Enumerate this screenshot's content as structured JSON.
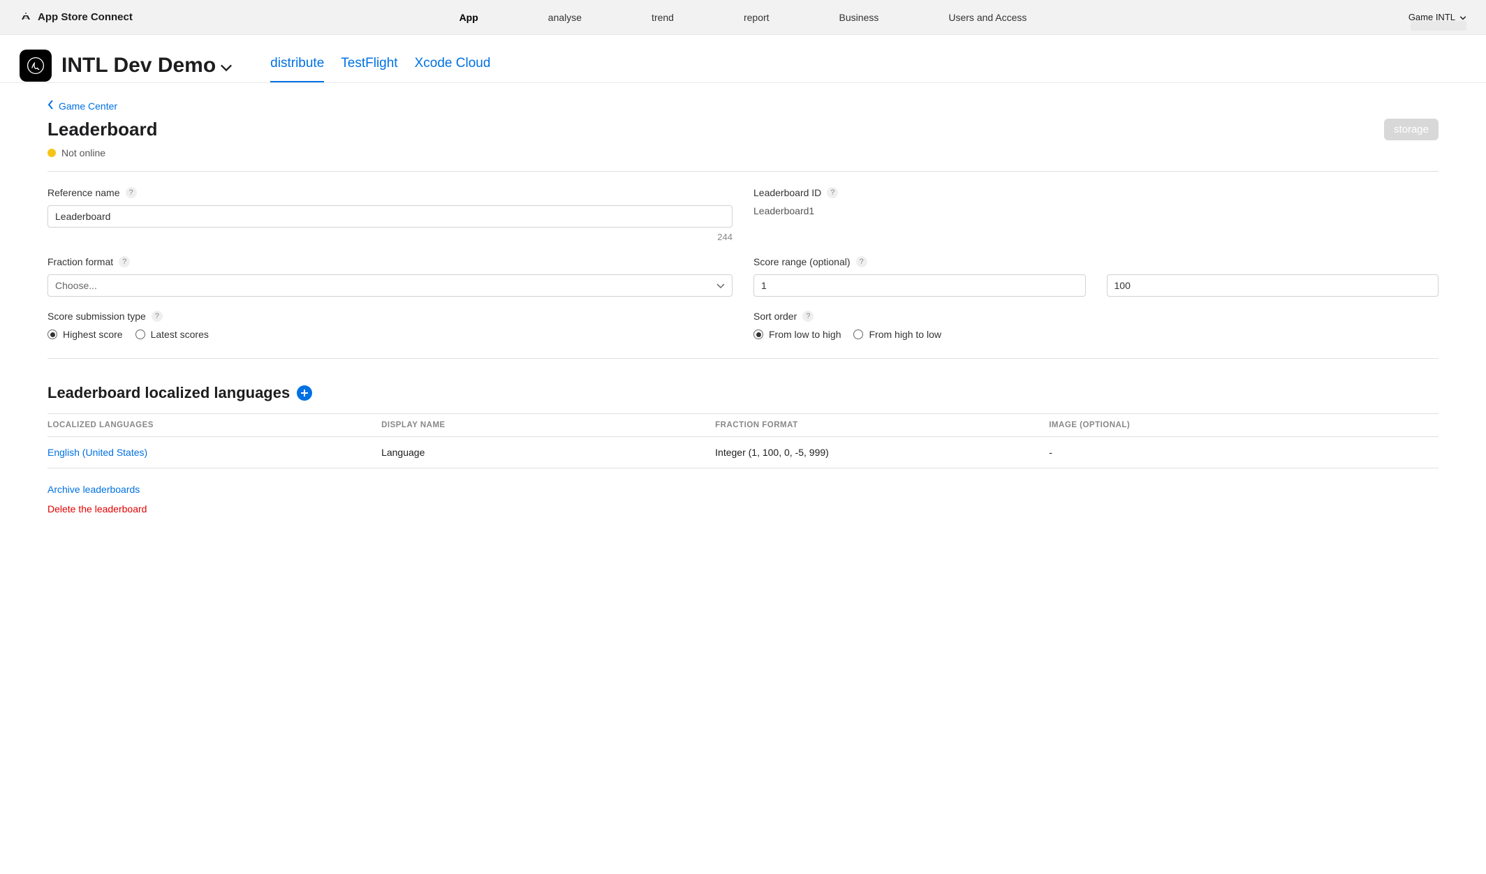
{
  "header": {
    "product": "App Store Connect",
    "nav": [
      "App",
      "analyse",
      "trend",
      "report",
      "Business",
      "Users and Access"
    ],
    "account": "Game INTL"
  },
  "app": {
    "title": "INTL Dev Demo",
    "tabs": [
      "distribute",
      "TestFlight",
      "Xcode Cloud"
    ]
  },
  "breadcrumb": "Game Center",
  "page": {
    "title": "Leaderboard",
    "storage_btn": "storage",
    "status": "Not online"
  },
  "form": {
    "reference_name": {
      "label": "Reference name",
      "value": "Leaderboard",
      "counter": "244"
    },
    "leaderboard_id": {
      "label": "Leaderboard ID",
      "value": "Leaderboard1"
    },
    "fraction_format": {
      "label": "Fraction format",
      "placeholder": "Choose..."
    },
    "score_range": {
      "label": "Score range (optional)",
      "min": "1",
      "max": "100"
    },
    "score_submission": {
      "label": "Score submission type",
      "opts": [
        "Highest score",
        "Latest scores"
      ]
    },
    "sort_order": {
      "label": "Sort order",
      "opts": [
        "From low to high",
        "From high to low"
      ]
    }
  },
  "languages": {
    "title": "Leaderboard localized languages",
    "headers": [
      "LOCALIZED LANGUAGES",
      "DISPLAY NAME",
      "FRACTION FORMAT",
      "IMAGE (OPTIONAL)"
    ],
    "rows": [
      {
        "lang": "English (United States)",
        "display": "Language",
        "fraction": "Integer (1, 100, 0, -5, 999)",
        "image": "-"
      }
    ]
  },
  "actions": {
    "archive": "Archive leaderboards",
    "delete": "Delete the leaderboard"
  }
}
